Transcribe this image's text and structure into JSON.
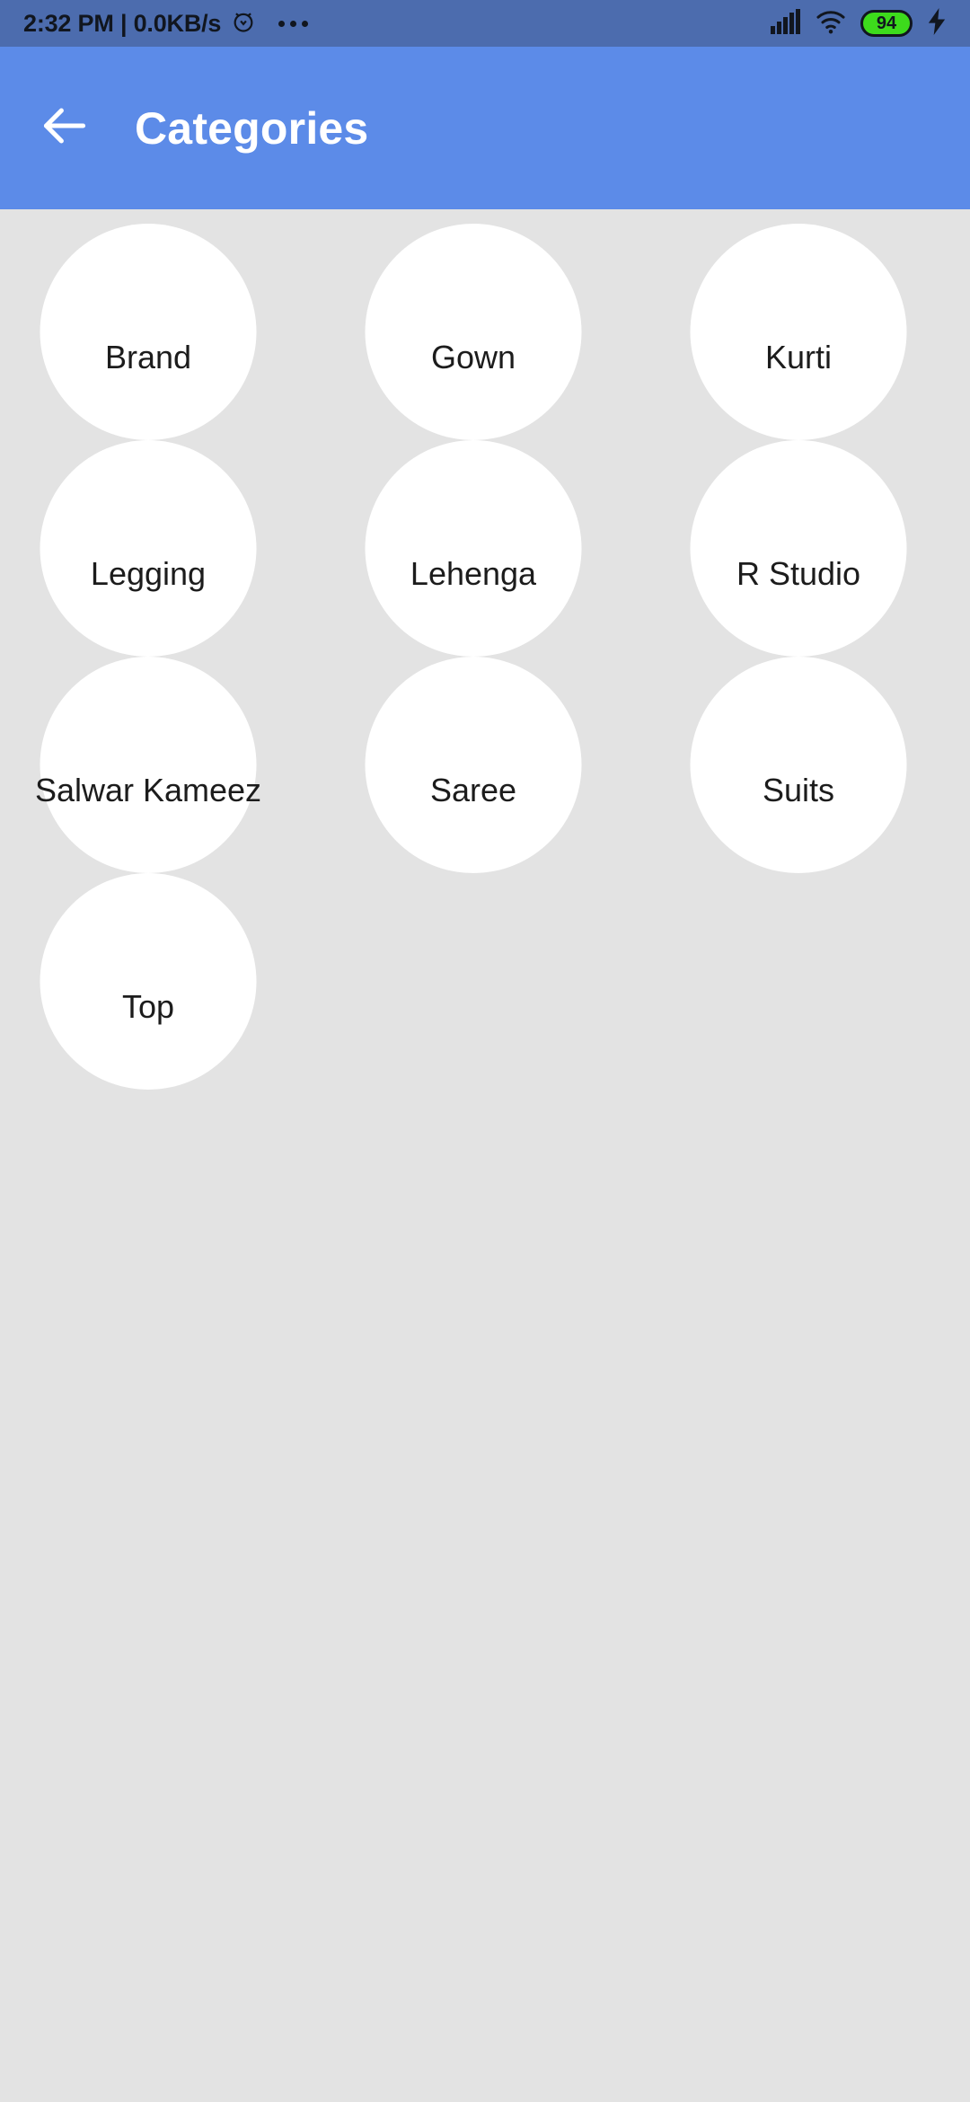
{
  "status_bar": {
    "background_color": "#4C6CAE",
    "clock_text": "2:32 PM | 0.0KB/s",
    "alarm_icon": "alarm-clock-icon",
    "overflow_icon": "overflow-dots-icon",
    "signal_icon": "cellular-signal-icon",
    "wifi_icon": "wifi-icon",
    "battery_level": "94",
    "battery_color": "#3DDB1C",
    "charging_icon": "charging-bolt-icon"
  },
  "app_bar": {
    "background_color": "#5C8BE8",
    "back_icon": "back-arrow-icon",
    "title": "Categories",
    "title_color": "#FFFFFF"
  },
  "grid": {
    "background_color": "#E3E3E3",
    "circle_color": "#FFFFFF",
    "label_color": "#1C1C1C",
    "columns": 3,
    "items": [
      {
        "label": "Brand"
      },
      {
        "label": "Gown"
      },
      {
        "label": "Kurti"
      },
      {
        "label": "Legging"
      },
      {
        "label": "Lehenga"
      },
      {
        "label": "R Studio"
      },
      {
        "label": "Salwar Kameez"
      },
      {
        "label": "Saree"
      },
      {
        "label": "Suits"
      },
      {
        "label": "Top"
      }
    ]
  }
}
